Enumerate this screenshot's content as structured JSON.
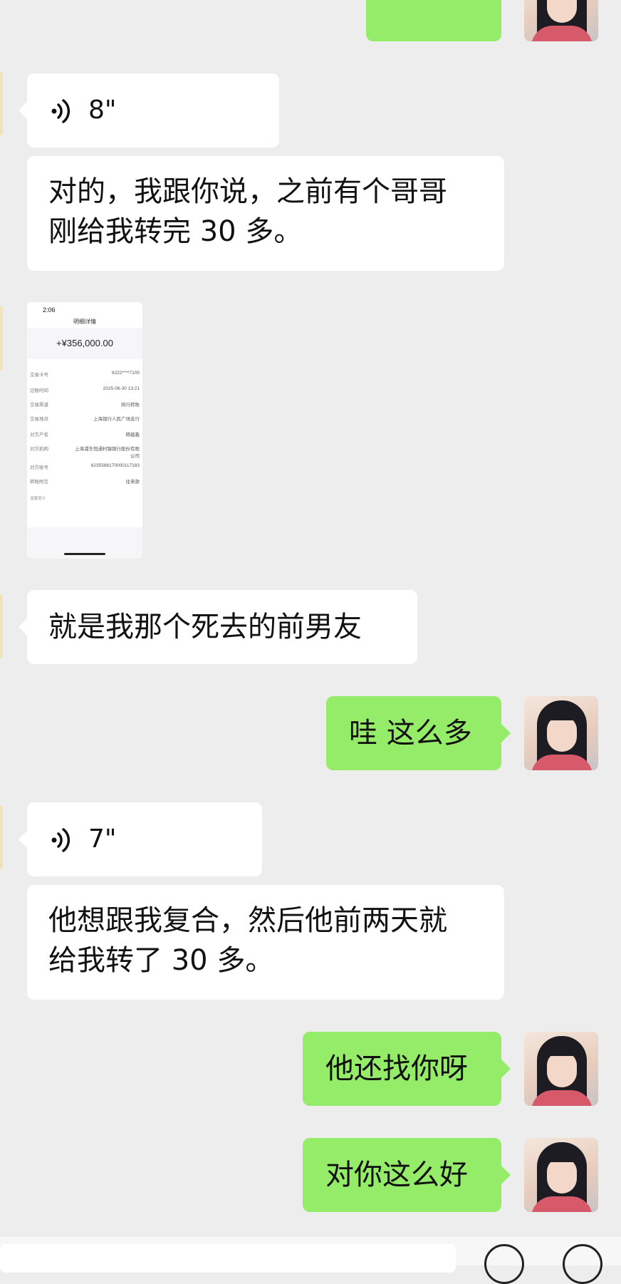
{
  "messages": {
    "voice1": {
      "duration": "8\""
    },
    "text1": {
      "line1": "对的，我跟你说，之前有个哥哥",
      "line2": "刚给我转完 30 多。"
    },
    "image1": {
      "time": "2:06",
      "title": "明细详情",
      "amount": "+¥356,000.00",
      "rows": [
        {
          "key": "交易卡号",
          "value": "6222****7105"
        },
        {
          "key": "记账时间",
          "value": "2025-06-30 13:21"
        },
        {
          "key": "交易渠道",
          "value": "跨行转账"
        },
        {
          "key": "交易地点",
          "value": "上海银行人民广场支行"
        },
        {
          "key": "对方户名",
          "value": "韩建鑫"
        },
        {
          "key": "对方机构",
          "value": "上海浦东恒通村镇银行股份有限公司"
        },
        {
          "key": "对方账号",
          "value": "6235586170000117183"
        },
        {
          "key": "转账附言",
          "value": "往来款"
        }
      ],
      "note": "温馨提示"
    },
    "text2": {
      "line1": "就是我那个死去的前男友"
    },
    "sent1": {
      "text": "哇 这么多"
    },
    "voice2": {
      "duration": "7\""
    },
    "text3": {
      "line1": "他想跟我复合，然后他前两天就",
      "line2": "给我转了 30 多。"
    },
    "sent2": {
      "text": "他还找你呀"
    },
    "sent3": {
      "text": "对你这么好"
    }
  },
  "colors": {
    "background": "#ededed",
    "incoming": "#ffffff",
    "outgoing": "#95ec69"
  },
  "icons": [
    "voice-wave-icon",
    "avatar"
  ]
}
